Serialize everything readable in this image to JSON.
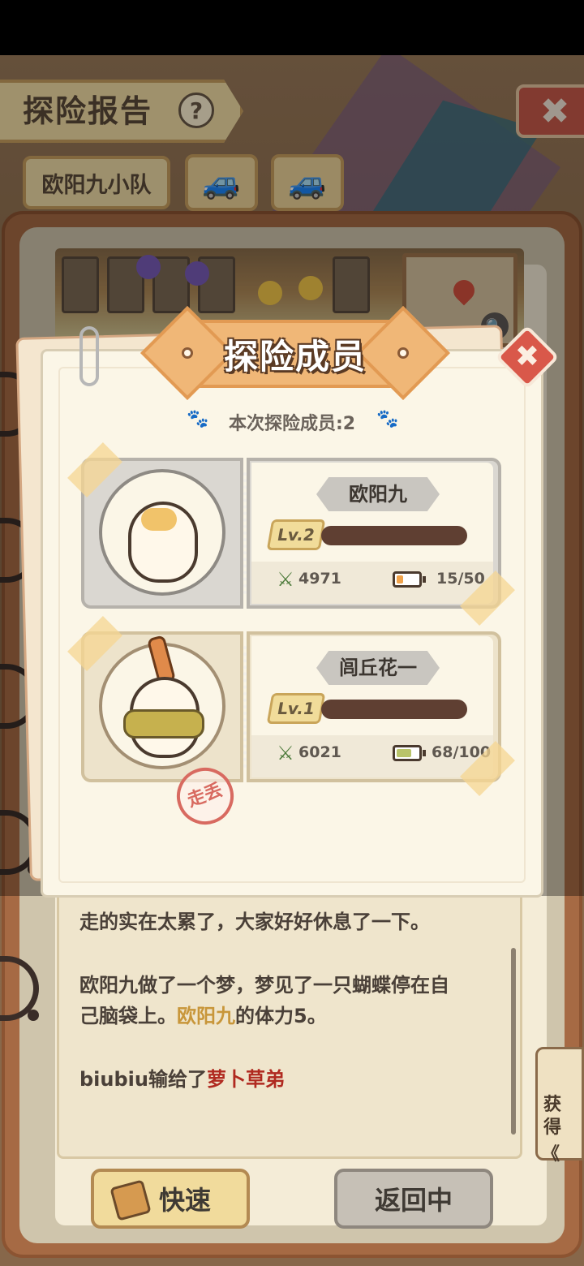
{
  "header": {
    "title": "探险报告",
    "help_icon": "?",
    "close_icon": "✖"
  },
  "tabs": {
    "team_label": "欧阳九小队",
    "car_icon": "🚙"
  },
  "map": {
    "zoom_icon": "🔍"
  },
  "log": {
    "lines": [
      "走的实在太累了，大家好好休息了一下。",
      "欧阳九做了一个梦，梦见了一只蝴蝶停在自",
      "己脑袋上。",
      "欧阳九",
      "的体力5。",
      "biubiu输给了",
      "萝卜草弟"
    ]
  },
  "side_tab": {
    "label": "获得",
    "arrow": "《"
  },
  "footer": {
    "quick_label": "快速",
    "return_label": "返回中"
  },
  "modal": {
    "title": "探险成员",
    "member_count": "本次探险成员:2",
    "paw_icon": "🐾",
    "close_icon": "✖",
    "members": [
      {
        "name": "欧阳九",
        "level": "Lv.2",
        "power": "4971",
        "stamina": "15/50",
        "stamina_level": 0.3,
        "stamina_color": "#f0a24a"
      },
      {
        "name": "闾丘花一",
        "level": "Lv.1",
        "power": "6021",
        "stamina": "68/100",
        "stamina_level": 0.68,
        "stamina_color": "#b9c46a",
        "status_stamp": "走丢"
      }
    ]
  },
  "colors": {
    "accent_orange": "#f0b777",
    "highlight_gold": "#c8963a",
    "highlight_red": "#b02a20",
    "close_red": "#d9584a"
  }
}
